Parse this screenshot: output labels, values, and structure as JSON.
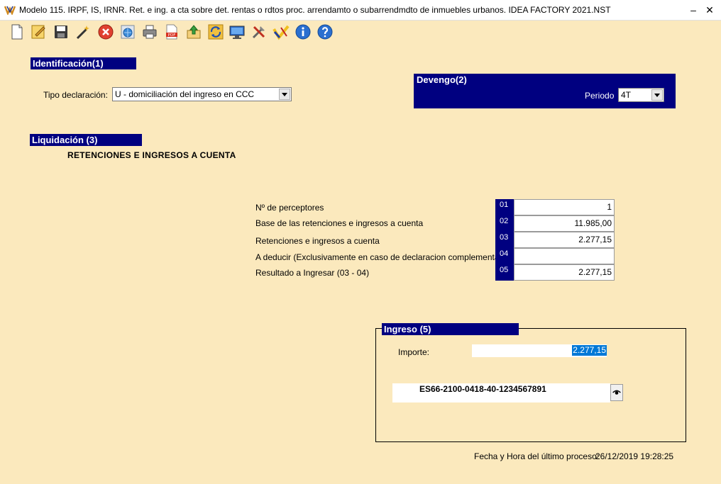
{
  "window": {
    "title": "Modelo 115. IRPF, IS, IRNR. Ret. e ing. a cta sobre det. rentas o rdtos proc. arrendamto o subarrendmdto de inmuebles urbanos. IDEA FACTORY 2021.NST",
    "minimize_label": "–",
    "close_label": "✕"
  },
  "toolbar": {
    "icons": [
      "new-document-icon",
      "edit-icon",
      "save-icon",
      "wand-icon",
      "delete-icon",
      "globe-icon",
      "print-icon",
      "pdf-icon",
      "export-icon",
      "refresh-icon",
      "monitor-icon",
      "tools-icon",
      "agency-icon",
      "info-icon",
      "help-icon"
    ]
  },
  "identificacion": {
    "heading": "Identificación(1)",
    "tipo_label": "Tipo declaración:",
    "tipo_value": "U - domiciliación del ingreso en CCC"
  },
  "devengo": {
    "heading": "Devengo(2)",
    "periodo_label": "Periodo",
    "periodo_value": "4T"
  },
  "liquidacion": {
    "heading": "Liquidación (3)",
    "subtitle": "RETENCIONES E INGRESOS A CUENTA",
    "rows": [
      {
        "label": "Nº de perceptores",
        "casilla": "01",
        "value": "1"
      },
      {
        "label": "Base de las retenciones e ingresos a cuenta",
        "casilla": "02",
        "value": "11.985,00"
      },
      {
        "label": "Retenciones e ingresos a cuenta",
        "casilla": "03",
        "value": "2.277,15"
      },
      {
        "label": "A deducir (Exclusivamente en caso de declaracion complementaria)",
        "casilla": "04",
        "value": ""
      },
      {
        "label": "Resultado a Ingresar (03 - 04)",
        "casilla": "05",
        "value": "2.277,15"
      }
    ]
  },
  "ingreso": {
    "heading": "Ingreso (5)",
    "importe_label": "Importe:",
    "importe_value": "2.277,15",
    "iban": "ES66-2100-0418-40-1234567891"
  },
  "footer": {
    "fecha_label": "Fecha y Hora del último proceso:",
    "fecha_value": "26/12/2019 19:28:25"
  },
  "colors": {
    "background": "#fbe9bd",
    "section_header": "#000080",
    "selection": "#0078d7"
  }
}
